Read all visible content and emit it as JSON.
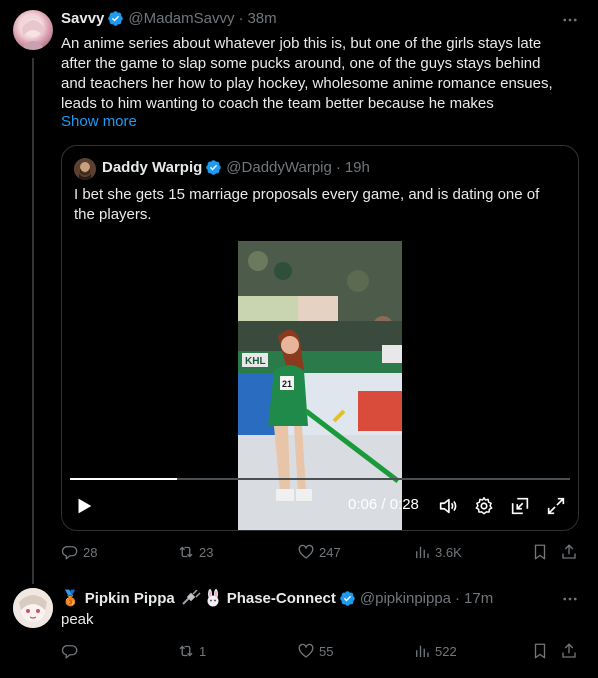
{
  "tweets": [
    {
      "name": "Savvy",
      "handle": "@MadamSavvy",
      "time": "38m",
      "text_lines": [
        "An anime series about whatever job this is, but one of the girls stays late",
        "after the game to slap some pucks around, one of the guys stays behind",
        "and teachers her how to play hockey, wholesome anime romance ensues,",
        "leads to him wanting to coach the team better because he makes"
      ],
      "show_more": "Show more",
      "stats": {
        "replies": "28",
        "reposts": "23",
        "likes": "247",
        "views": "3.6K"
      }
    },
    {
      "name_prefix_emoji": "🥉",
      "name_part1": "Pipkin Pippa",
      "name_part2": "Phase-Connect",
      "handle": "@pipkinpippa",
      "time": "17m",
      "text": "peak",
      "stats": {
        "replies": "",
        "reposts": "1",
        "likes": "55",
        "views": "522"
      }
    }
  ],
  "quote": {
    "name": "Daddy Warpig",
    "handle": "@DaddyWarpig",
    "time": "19h",
    "text_lines": [
      "I bet she gets 15 marriage proposals every game, and is dating one of",
      "the players."
    ],
    "video": {
      "time_label": "0:06 / 0:28",
      "progress": 0.214,
      "board_text": "KHL",
      "jersey_number": "21"
    }
  },
  "colors": {
    "accent": "#1d9bf0",
    "muted": "#71767b",
    "text": "#e7e9ea",
    "border": "#2f3336"
  }
}
